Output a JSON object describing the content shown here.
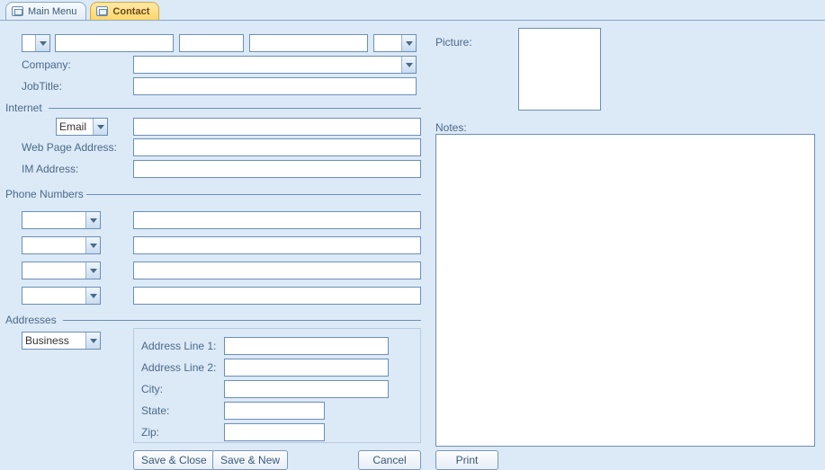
{
  "tabs": {
    "main_menu": "Main Menu",
    "contact": "Contact"
  },
  "top": {
    "company_label": "Company:",
    "jobtitle_label": "JobTitle:",
    "picture_label": "Picture:"
  },
  "internet": {
    "section": "Internet",
    "email_selected": "Email",
    "web_label": "Web Page Address:",
    "im_label": "IM Address:"
  },
  "phone": {
    "section": "Phone Numbers"
  },
  "addresses": {
    "section": "Addresses",
    "type_selected": "Business",
    "line1": "Address Line 1:",
    "line2": "Address Line 2:",
    "city": "City:",
    "state": "State:",
    "zip": "Zip:"
  },
  "notes": {
    "label": "Notes:"
  },
  "buttons": {
    "save_close": "Save & Close",
    "save_new": "Save & New",
    "cancel": "Cancel",
    "print": "Print"
  }
}
